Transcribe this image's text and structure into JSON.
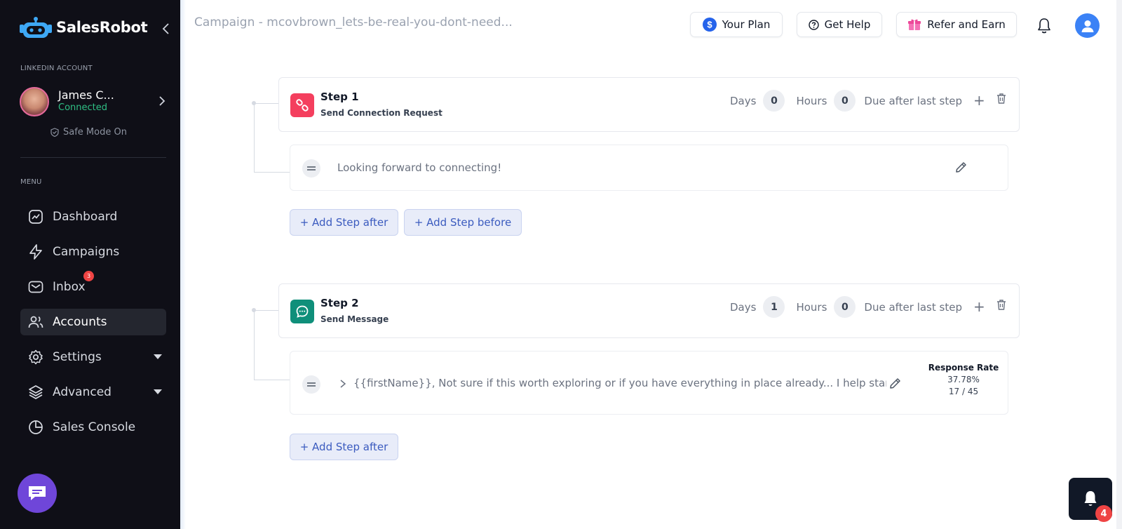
{
  "sidebar": {
    "logo_text": "SalesRobot",
    "linkedin_label": "LINKEDIN ACCOUNT",
    "account": {
      "name": "James C...",
      "status": "Connected"
    },
    "safe_mode": "Safe Mode On",
    "menu_label": "MENU",
    "items": [
      {
        "label": "Dashboard",
        "icon": "dashboard-icon"
      },
      {
        "label": "Campaigns",
        "icon": "lightning-icon"
      },
      {
        "label": "Inbox",
        "icon": "mail-icon",
        "badge": "3"
      },
      {
        "label": "Accounts",
        "icon": "users-icon",
        "active": true
      },
      {
        "label": "Settings",
        "icon": "gear-icon"
      },
      {
        "label": "Advanced",
        "icon": "layers-icon"
      },
      {
        "label": "Sales Console",
        "icon": "pie-chart-icon"
      }
    ]
  },
  "header": {
    "campaign_title": "Campaign - mcovbrown_lets-be-real-you-dont-need...",
    "your_plan": "Your Plan",
    "get_help": "Get Help",
    "refer": "Refer and Earn"
  },
  "steps": [
    {
      "title": "Step 1",
      "subtitle": "Send Connection Request",
      "days_label": "Days",
      "days": "0",
      "hours_label": "Hours",
      "hours": "0",
      "due": "Due after last step",
      "message": "Looking forward to connecting!",
      "add_after": "+ Add Step after",
      "add_before": "+ Add Step before"
    },
    {
      "title": "Step 2",
      "subtitle": "Send Message",
      "days_label": "Days",
      "days": "1",
      "hours_label": "Hours",
      "hours": "0",
      "due": "Due after last step",
      "message": "{{firstName}}, Not sure if this worth exploring or if you have everything in place already... I help start ...",
      "response_title": "Response Rate",
      "response_rate": "37.78%",
      "response_count": "17 / 45",
      "add_after": "+ Add Step after"
    }
  ],
  "notifications": {
    "count": "4"
  },
  "colors": {
    "step1": "#f43f5e",
    "step2": "#0f8f7a",
    "accent": "#3b5bbf",
    "sidebar": "#0f0f17"
  }
}
